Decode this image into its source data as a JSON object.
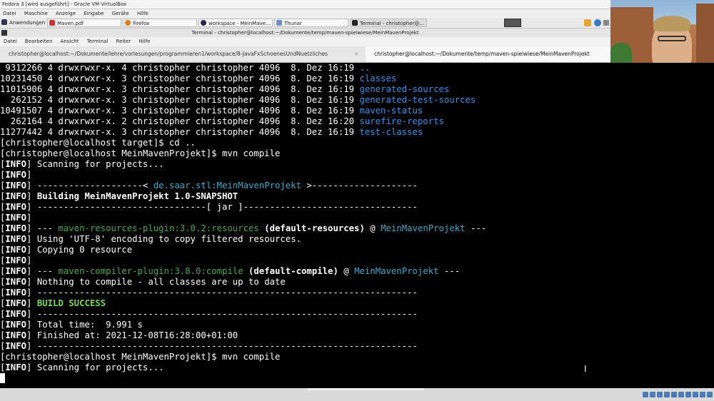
{
  "vbox": {
    "title": "Fedora 3 [wird ausgeführt] - Oracle VM VirtualBox",
    "menu": [
      "Datei",
      "Maschine",
      "Anzeige",
      "Eingabe",
      "Geräte",
      "Hilfe"
    ]
  },
  "taskbar": {
    "apps_label": "Anwendungen",
    "tasks": [
      "Maven.pdf",
      "Firefox",
      "workspace - MeinMave...",
      "Thunar",
      "Terminal - christopher@..."
    ]
  },
  "terminal_window": {
    "title": "Terminal - christopher@localhost:~/Dokumente/temp/maven-spielwiese/MeinMavenProjekt",
    "menu": [
      "Datei",
      "Bearbeiten",
      "Ansicht",
      "Terminal",
      "Reiter",
      "Hilfe"
    ],
    "tabs": [
      "christopher@localhost:~/Dokumente/lehre/vorlesungen/programmieren1/workspace/8-JavaFxSchoenesUndNuetzliches",
      "christopher@localhost:~/Dokumente/temp/maven-spielwiese/MeinMavenProjekt"
    ],
    "tab_close": "×"
  },
  "ls": [
    {
      "pre": " 9312266 4 drwxrwxr-x. 4 christopher christopher 4096  8. Dez 16:19 ",
      "name": ".."
    },
    {
      "pre": "10231450 4 drwxrwxr-x. 3 christopher christopher 4096  8. Dez 16:19 ",
      "name": "classes"
    },
    {
      "pre": "11015906 4 drwxrwxr-x. 3 christopher christopher 4096  8. Dez 16:19 ",
      "name": "generated-sources"
    },
    {
      "pre": "  262152 4 drwxrwxr-x. 3 christopher christopher 4096  8. Dez 16:19 ",
      "name": "generated-test-sources"
    },
    {
      "pre": "10491507 4 drwxrwxr-x. 3 christopher christopher 4096  8. Dez 16:19 ",
      "name": "maven-status"
    },
    {
      "pre": "  262164 4 drwxrwxr-x. 2 christopher christopher 4096  8. Dez 16:20 ",
      "name": "surefire-reports"
    },
    {
      "pre": "11277442 4 drwxrwxr-x. 3 christopher christopher 4096  8. Dez 16:19 ",
      "name": "test-classes"
    }
  ],
  "prompt_cd": "[christopher@localhost target]$ cd ..",
  "prompt_compile": "[christopher@localhost MeinMavenProjekt]$ mvn compile",
  "info": {
    "open": "[",
    "tag": "INFO",
    "close": "] ",
    "scanning": "Scanning for projects...",
    "sep_left": "--------------------< ",
    "artifact": "de.saar.stl:MeinMavenProjekt",
    "sep_right": " >--------------------",
    "building": "Building MeinMavenProjekt 1.0-SNAPSHOT",
    "jar_line": "--------------------------------[ jar ]---------------------------------",
    "res_prefix": "--- ",
    "res_plugin": "maven-resources-plugin:3.0.2:resources",
    "res_goal": " (default-resources)",
    "res_at": " @ ",
    "project": "MeinMavenProjekt",
    "res_suffix": " ---",
    "encoding": "Using 'UTF-8' encoding to copy filtered resources.",
    "copying": "Copying 0 resource",
    "comp_plugin": "maven-compiler-plugin:3.8.0:compile",
    "comp_goal": " (default-compile)",
    "nothing": "Nothing to compile - all classes are up to date",
    "dashes": "------------------------------------------------------------------------",
    "success": "BUILD SUCCESS",
    "total_time": "Total time:  9.991 s",
    "finished": "Finished at: 2021-12-08T16:28:00+01:00"
  },
  "ibeam": "I",
  "colors": {
    "info_tag": "#5c8fe6",
    "dir": "#3b8fe6",
    "plugin": "#4aa84a",
    "success": "#7bd65d",
    "project": "#3fa6c9"
  }
}
